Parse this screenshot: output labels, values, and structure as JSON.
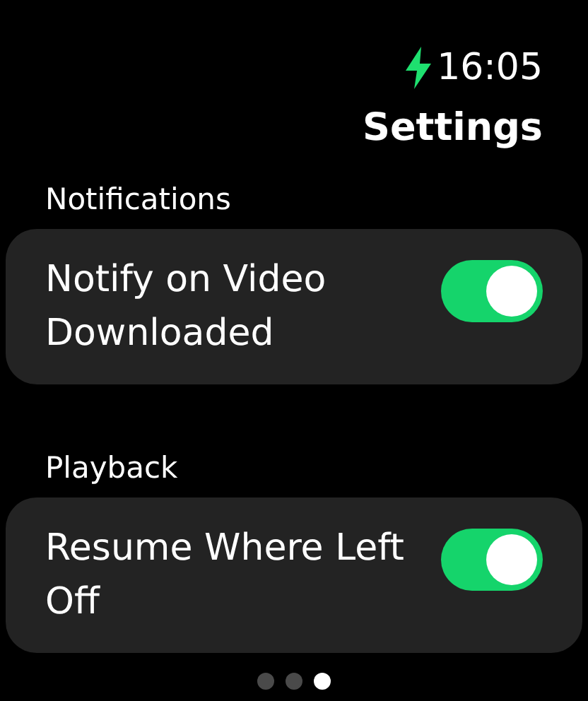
{
  "status_bar": {
    "charging": true,
    "time": "16:05"
  },
  "title": "Settings",
  "sections": [
    {
      "header": "Notifications",
      "items": [
        {
          "label": "Notify on Video Downloaded",
          "on": true
        }
      ]
    },
    {
      "header": "Playback",
      "items": [
        {
          "label": "Resume Where Left Off",
          "on": true
        }
      ]
    }
  ],
  "page_dots": [
    {
      "selected": false
    },
    {
      "selected": false
    },
    {
      "selected": true
    }
  ]
}
